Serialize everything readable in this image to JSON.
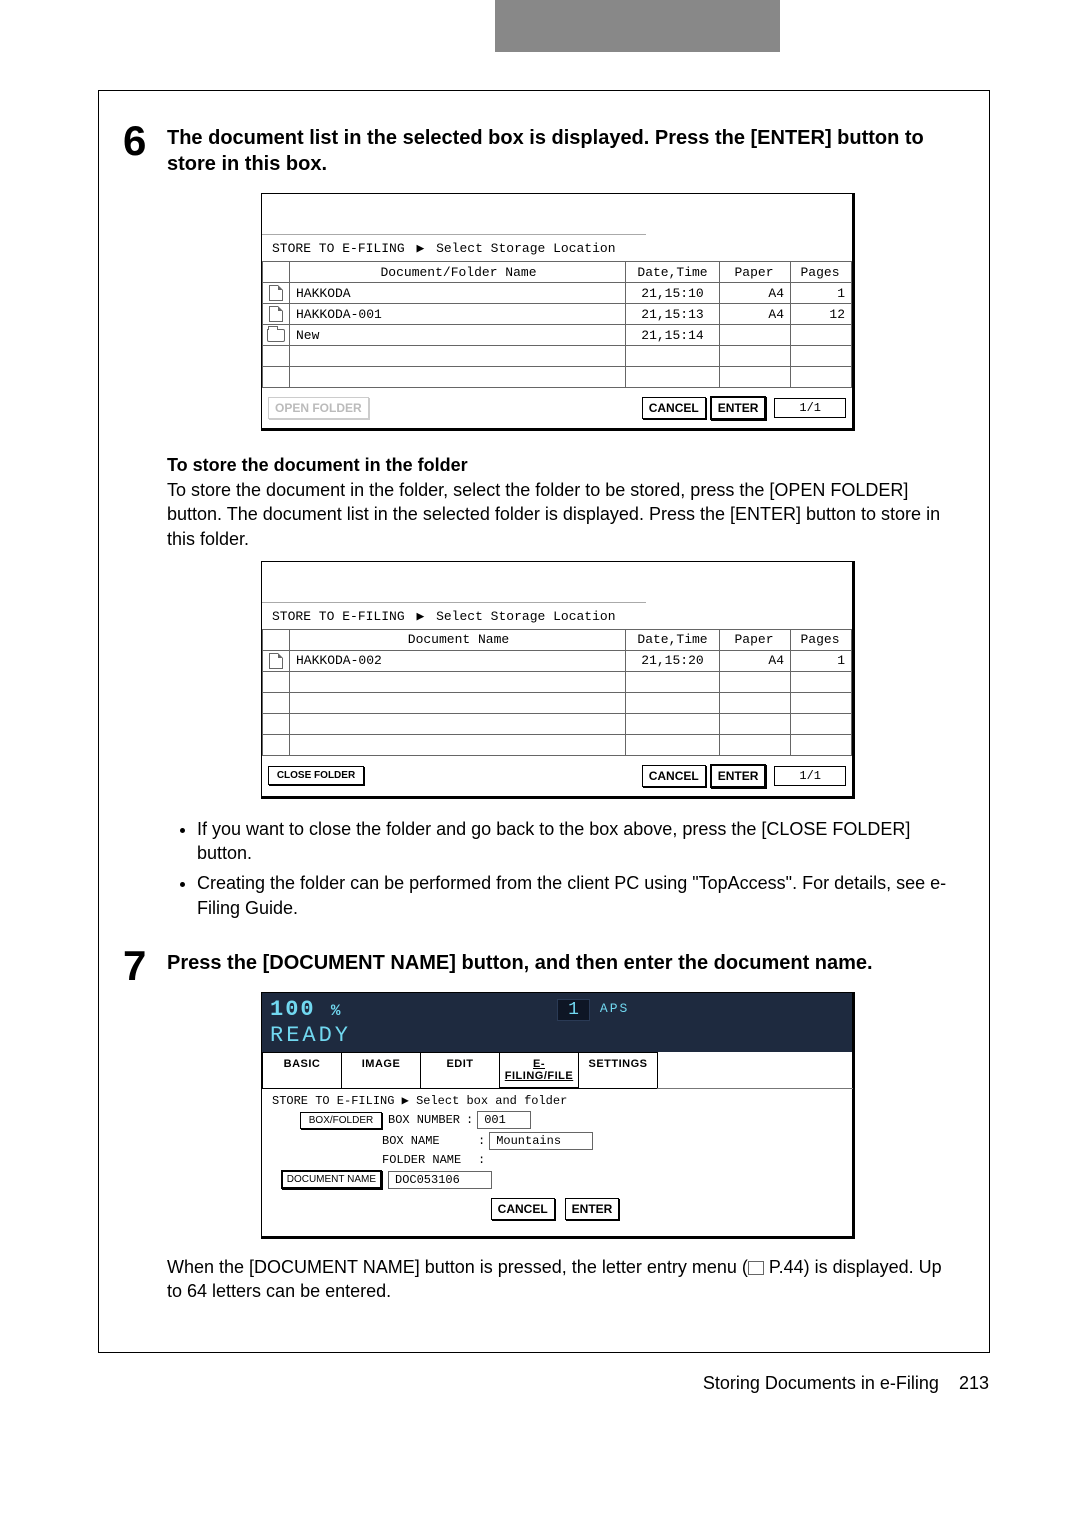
{
  "step6": {
    "number": "6",
    "title": "The document list in the selected box is displayed. Press the [ENTER] button to store in this box.",
    "panel": {
      "breadcrumb1": "STORE TO E-FILING",
      "breadcrumb2": "Select Storage Location",
      "headers": {
        "name": "Document/Folder Name",
        "date": "Date,Time",
        "paper": "Paper",
        "pages": "Pages"
      },
      "rows": [
        {
          "ico": "doc",
          "name": "HAKKODA",
          "date": "21,15:10",
          "paper": "A4",
          "pages": "1"
        },
        {
          "ico": "doc",
          "name": "HAKKODA-001",
          "date": "21,15:13",
          "paper": "A4",
          "pages": "12"
        },
        {
          "ico": "folder",
          "name": "New",
          "date": "21,15:14",
          "paper": "",
          "pages": ""
        }
      ],
      "open_folder": "OPEN FOLDER",
      "cancel": "CANCEL",
      "enter": "ENTER",
      "pager": "1/1"
    },
    "sub_heading": "To store the document in the folder",
    "paragraph": "To store the document in the folder, select the folder to be stored, press the [OPEN FOLDER] button. The document list in the selected folder is displayed. Press the [ENTER] button to store in this folder.",
    "panel2": {
      "breadcrumb1": "STORE TO E-FILING",
      "breadcrumb2": "Select Storage Location",
      "headers": {
        "name": "Document Name",
        "date": "Date,Time",
        "paper": "Paper",
        "pages": "Pages"
      },
      "rows": [
        {
          "ico": "doc",
          "name": "HAKKODA-002",
          "date": "21,15:20",
          "paper": "A4",
          "pages": "1"
        }
      ],
      "close_folder": "CLOSE FOLDER",
      "cancel": "CANCEL",
      "enter": "ENTER",
      "pager": "1/1"
    },
    "bullets": [
      "If you want to close the folder and go back to the box above, press the [CLOSE FOLDER] button.",
      "Creating the folder can be performed from the client PC using \"TopAccess\". For details, see e-Filing Guide."
    ]
  },
  "step7": {
    "number": "7",
    "title": "Press the [DOCUMENT NAME] button, and then enter the document name.",
    "panel": {
      "percent_value": "100",
      "percent_sign": "%",
      "number_badge": "1",
      "aps": "APS",
      "ready": "READY",
      "tabs": {
        "basic": "BASIC",
        "image": "IMAGE",
        "edit": "EDIT",
        "efile": "E-FILING/FILE",
        "settings": "SETTINGS"
      },
      "breadcrumb1": "STORE TO E-FILING",
      "breadcrumb2": "Select box and folder",
      "box_folder_btn": "BOX/FOLDER",
      "labels": {
        "box_number": "BOX NUMBER",
        "box_name": "BOX NAME",
        "folder_name": "FOLDER NAME"
      },
      "box_number_value": "001",
      "box_name_value": "Mountains",
      "folder_name_value": "",
      "doc_name_btn": "DOCUMENT NAME",
      "doc_name_value": "DOC053106",
      "cancel": "CANCEL",
      "enter": "ENTER"
    },
    "paragraph_prefix": "When the [DOCUMENT NAME] button is pressed, the letter entry menu (",
    "page_ref": " P.44",
    "paragraph_suffix": ") is displayed. Up to 64 letters can be entered."
  },
  "footer": {
    "text": "Storing Documents in e-Filing",
    "page": "213"
  }
}
